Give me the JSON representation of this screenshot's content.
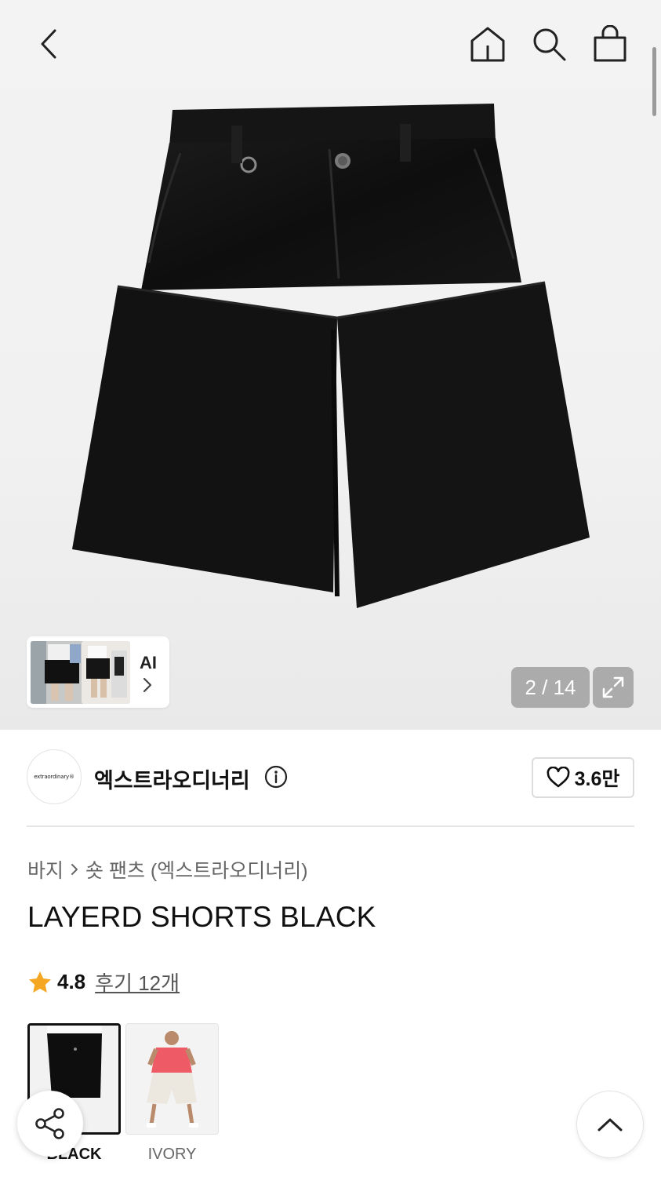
{
  "gallery": {
    "counter": "2 / 14",
    "ai_label": "AI"
  },
  "brand": {
    "logo_text": "extraordinary®",
    "name": "엑스트라오디너리",
    "likes": "3.6만"
  },
  "breadcrumb": {
    "category": "바지",
    "subcategory": "숏 팬츠 (엑스트라오디너리)"
  },
  "product": {
    "title": "LAYERD SHORTS BLACK",
    "rating": "4.8",
    "reviews": "후기 12개"
  },
  "colors": [
    {
      "name": "BLACK",
      "selected": true
    },
    {
      "name": "IVORY",
      "selected": false
    }
  ],
  "icons": {
    "back": "chevron-left-icon",
    "home": "home-icon",
    "search": "search-icon",
    "cart": "shopping-bag-icon",
    "expand": "expand-icon",
    "info": "info-icon",
    "heart": "heart-icon",
    "star": "star-icon",
    "share": "share-icon",
    "top": "chevron-up-icon"
  },
  "accent": {
    "star": "#F5A623",
    "text": "#111111"
  }
}
